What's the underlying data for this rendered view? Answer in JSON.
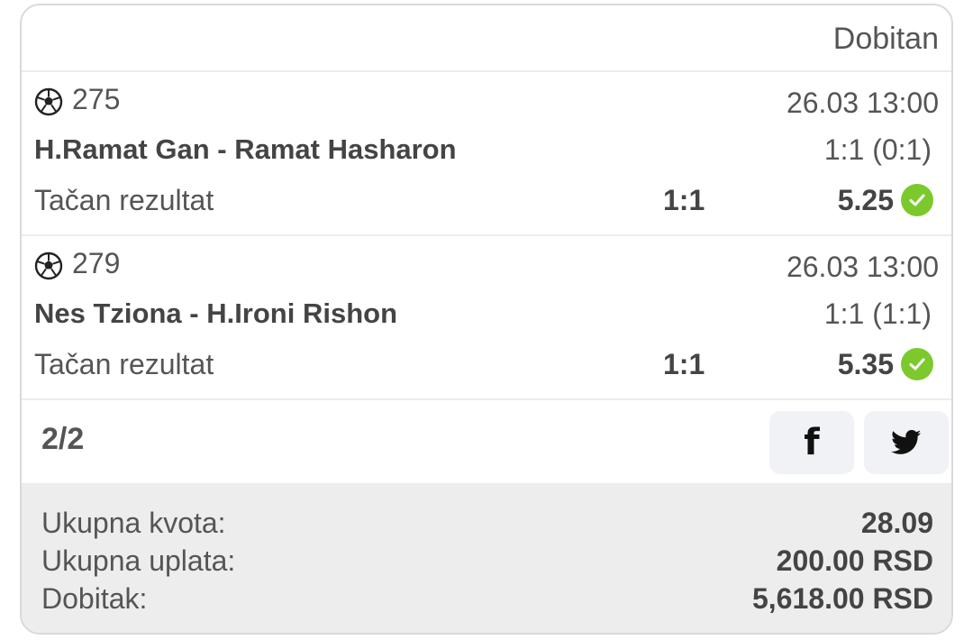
{
  "header": {
    "status": "Dobitan"
  },
  "events": [
    {
      "code": "275",
      "datetime": "26.03 13:00",
      "teams": "H.Ramat Gan - Ramat Hasharon",
      "result": "1:1 (0:1)",
      "market": "Tačan rezultat",
      "pick": "1:1",
      "odd": "5.25",
      "icon": "soccer-ball-icon",
      "status_icon": "check-circle-icon"
    },
    {
      "code": "279",
      "datetime": "26.03 13:00",
      "teams": "Nes Tziona - H.Ironi Rishon",
      "result": "1:1 (1:1)",
      "market": "Tačan rezultat",
      "pick": "1:1",
      "odd": "5.35",
      "icon": "soccer-ball-icon",
      "status_icon": "check-circle-icon"
    }
  ],
  "count": "2/2",
  "share": {
    "facebook_icon": "facebook-icon",
    "twitter_icon": "twitter-icon"
  },
  "summary": {
    "total_odds_label": "Ukupna kvota:",
    "total_odds_value": "28.09",
    "stake_label": "Ukupna uplata:",
    "stake_value": "200.00 RSD",
    "payout_label": "Dobitak:",
    "payout_value": "5,618.00 RSD"
  },
  "colors": {
    "win_green": "#7cc92e",
    "summary_bg": "#ededed",
    "border": "#d9d9d9"
  }
}
